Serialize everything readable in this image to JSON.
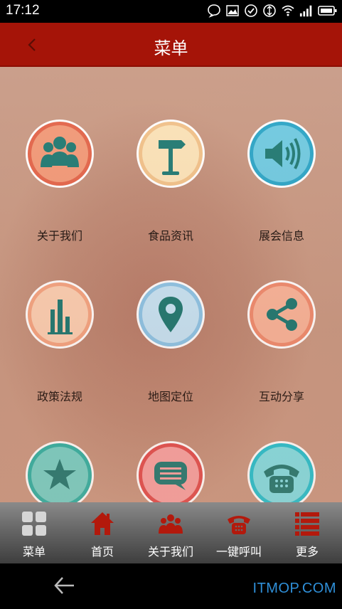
{
  "status_bar": {
    "time": "17:12",
    "icons": [
      "chat-bubble-icon",
      "image-icon",
      "check-circle-icon",
      "sync-icon",
      "wifi-icon",
      "signal-icon",
      "battery-icon"
    ]
  },
  "header": {
    "title": "菜单",
    "back_icon": "chevron-left-icon",
    "background": "#a51408"
  },
  "menu": {
    "items": [
      {
        "label": "关于我们",
        "icon": "people-icon",
        "ring": "#e3654a",
        "fill": "#f29a78"
      },
      {
        "label": "食品资讯",
        "icon": "signpost-icon",
        "ring": "#f1c28a",
        "fill": "#fbe3b8"
      },
      {
        "label": "展会信息",
        "icon": "speaker-icon",
        "ring": "#2ba6c8",
        "fill": "#6fcbe2"
      },
      {
        "label": "政策法规",
        "icon": "bar-chart-icon",
        "ring": "#f4a683",
        "fill": "#fbd0b3"
      },
      {
        "label": "地图定位",
        "icon": "map-pin-icon",
        "ring": "#8cc6e8",
        "fill": "#c6e5f6"
      },
      {
        "label": "互动分享",
        "icon": "share-icon",
        "ring": "#ef8d70",
        "fill": "#f8b59a"
      },
      {
        "label": "",
        "icon": "star-icon",
        "ring": "#2db3a6",
        "fill": "#74d2c8"
      },
      {
        "label": "",
        "icon": "message-icon",
        "ring": "#e04f4f",
        "fill": "#f6a3a3"
      },
      {
        "label": "",
        "icon": "phone-icon",
        "ring": "#22c3d2",
        "fill": "#80e0e6"
      }
    ]
  },
  "tabbar": {
    "items": [
      {
        "label": "菜单",
        "icon": "grid-icon"
      },
      {
        "label": "首页",
        "icon": "home-icon"
      },
      {
        "label": "关于我们",
        "icon": "people-icon"
      },
      {
        "label": "一键呼叫",
        "icon": "telephone-icon"
      },
      {
        "label": "更多",
        "icon": "list-icon"
      }
    ]
  },
  "nav": {
    "back_icon": "arrow-left-icon",
    "watermark": "ITMOP.COM"
  },
  "colors": {
    "accent": "#a51408",
    "icon_teal": "#1f7a73",
    "tab_icon_red": "#b3190c"
  }
}
